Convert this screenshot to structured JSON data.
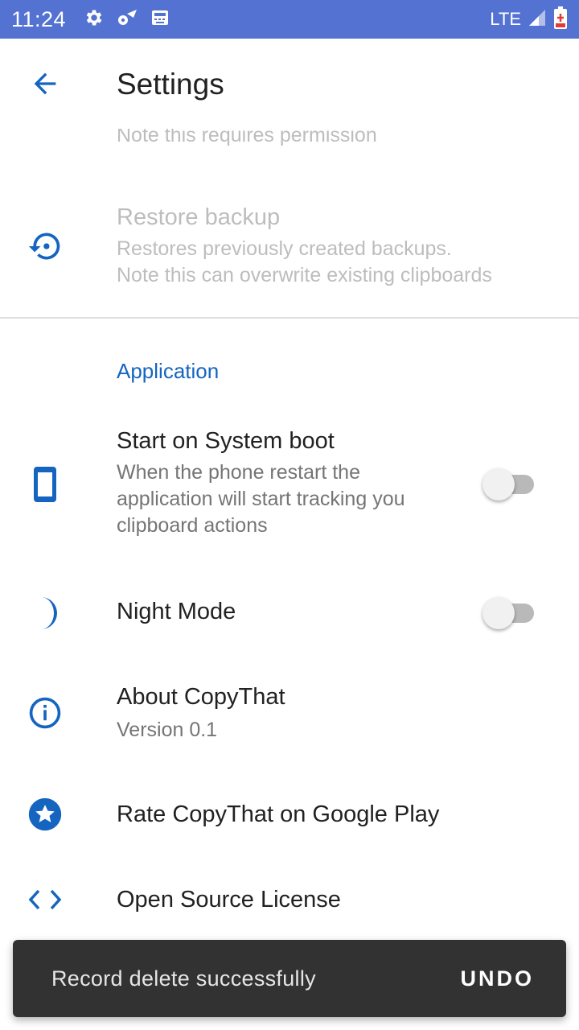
{
  "status_bar": {
    "time": "11:24",
    "network": "LTE",
    "left_icons": [
      "gear-icon",
      "cog-wifi-icon",
      "keyboard-icon"
    ],
    "right_icons": [
      "signal-icon",
      "battery-icon"
    ]
  },
  "app_bar": {
    "title": "Settings",
    "back_icon": "arrow-back-icon"
  },
  "colors": {
    "status_bar": "#5372d1",
    "accent": "#1565c0",
    "snackbar": "#323232"
  },
  "preferences": {
    "partial_summary": "Note this requires permission",
    "restore_backup": {
      "title": "Restore backup",
      "summary_line1": "Restores previously created backups.",
      "summary_line2": "Note this can overwrite existing clipboards",
      "icon": "restore-icon",
      "enabled": false
    },
    "category_application": "Application",
    "start_on_boot": {
      "title": "Start on System boot",
      "summary_line1": "When the phone restart the",
      "summary_line2": "application will start tracking you",
      "summary_line3": "clipboard actions",
      "icon": "phone-icon",
      "checked": false
    },
    "night_mode": {
      "title": "Night Mode",
      "icon": "moon-icon",
      "checked": false
    },
    "about": {
      "title": "About CopyThat",
      "summary": "Version 0.1",
      "icon": "info-icon"
    },
    "rate": {
      "title": "Rate CopyThat on Google Play",
      "icon": "star-icon"
    },
    "license": {
      "title": "Open Source License",
      "icon": "code-icon"
    }
  },
  "snackbar": {
    "message": "Record delete successfully",
    "action": "UNDO"
  }
}
